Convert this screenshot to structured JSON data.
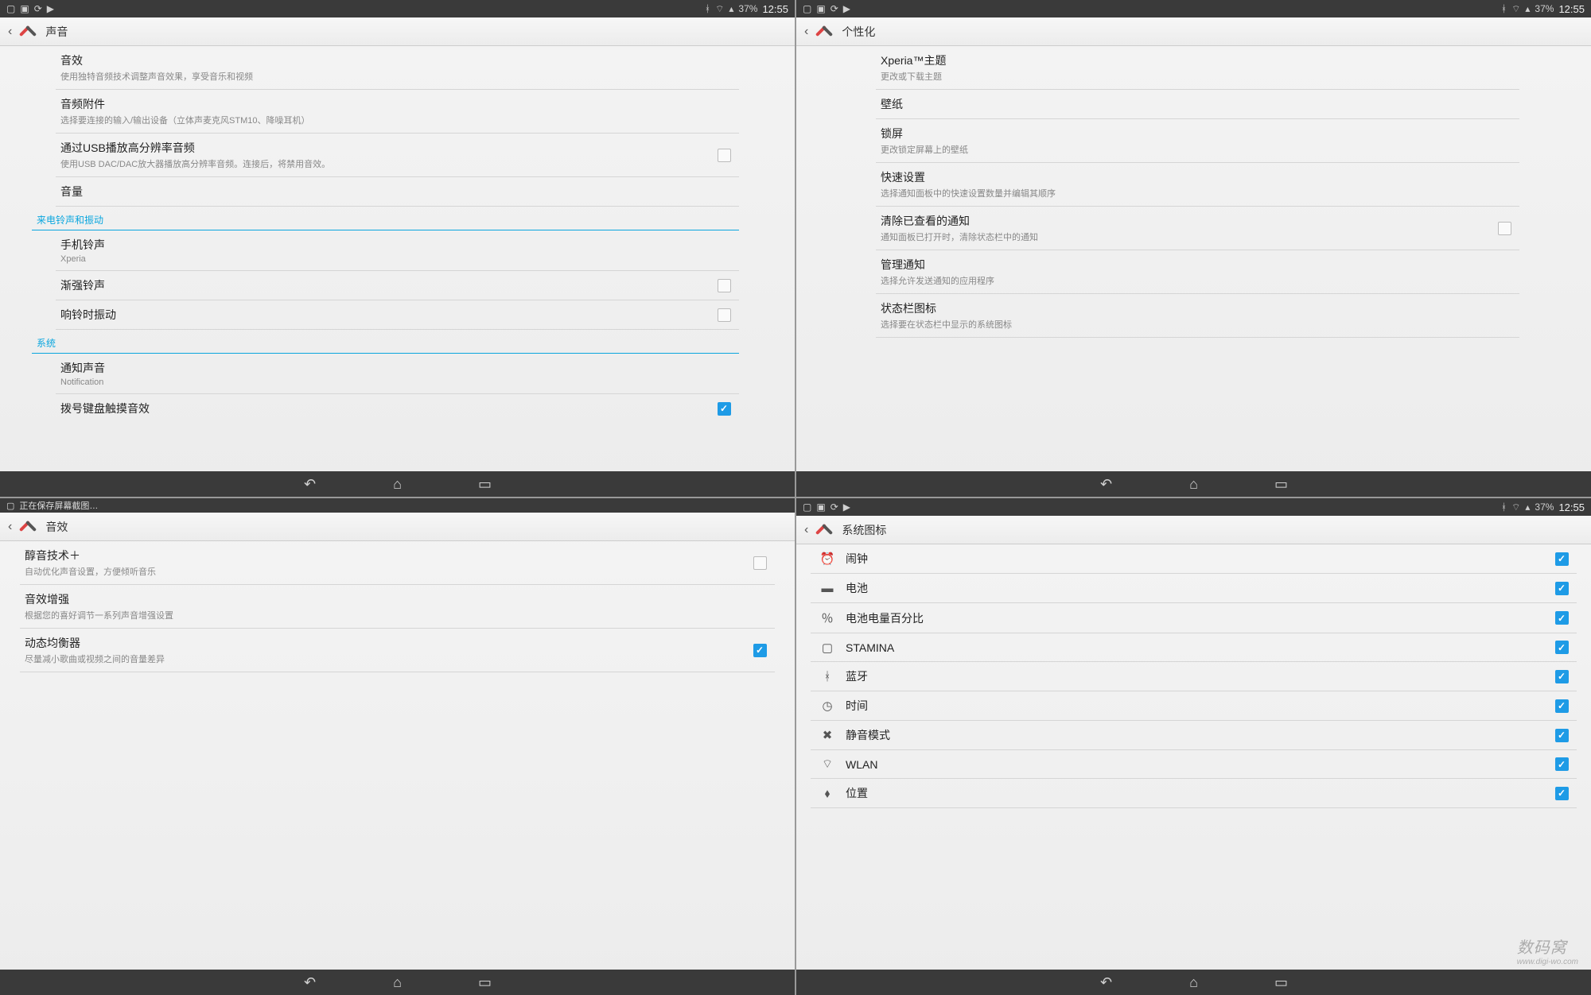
{
  "status": {
    "clock": "12:55",
    "battery": "37%"
  },
  "watermark": {
    "big": "数码窝",
    "small": "www.digi-wo.com"
  },
  "p1": {
    "title": "声音",
    "rows": [
      {
        "k": "sfx",
        "ttl": "音效",
        "sub": "使用独特音频技术调整声音效果，享受音乐和视频"
      },
      {
        "k": "acc",
        "ttl": "音频附件",
        "sub": "选择要连接的输入/输出设备（立体声麦克风STM10、降噪耳机）"
      },
      {
        "k": "usb",
        "ttl": "通过USB播放高分辨率音频",
        "sub": "使用USB DAC/DAC放大器播放高分辨率音频。连接后，将禁用音效。",
        "chk": false
      },
      {
        "k": "vol",
        "ttl": "音量"
      }
    ],
    "cat1": "来电铃声和振动",
    "rows2": [
      {
        "k": "ring",
        "ttl": "手机铃声",
        "sub": "Xperia"
      },
      {
        "k": "asc",
        "ttl": "渐强铃声",
        "chk": false
      },
      {
        "k": "vib",
        "ttl": "响铃时振动",
        "chk": false
      }
    ],
    "cat2": "系统",
    "rows3": [
      {
        "k": "notif",
        "ttl": "通知声音",
        "sub": "Notification"
      },
      {
        "k": "dial",
        "ttl": "拨号键盘触摸音效",
        "chk": true
      }
    ]
  },
  "p2": {
    "title": "个性化",
    "rows": [
      {
        "k": "theme",
        "ttl": "Xperia™主题",
        "sub": "更改或下载主题"
      },
      {
        "k": "wall",
        "ttl": "壁纸"
      },
      {
        "k": "lock",
        "ttl": "锁屏",
        "sub": "更改锁定屏幕上的壁纸"
      },
      {
        "k": "quick",
        "ttl": "快速设置",
        "sub": "选择通知面板中的快速设置数量并编辑其顺序"
      },
      {
        "k": "clear",
        "ttl": "清除已查看的通知",
        "sub": "通知面板已打开时，清除状态栏中的通知",
        "chk": false
      },
      {
        "k": "mng",
        "ttl": "管理通知",
        "sub": "选择允许发送通知的应用程序"
      },
      {
        "k": "icons",
        "ttl": "状态栏图标",
        "sub": "选择要在状态栏中显示的系统图标"
      }
    ]
  },
  "p3": {
    "title": "音效",
    "banner": "正在保存屏幕截图…",
    "rows": [
      {
        "k": "clr",
        "ttl": "醇音技术＋",
        "sub": "自动优化声音设置，方便倾听音乐",
        "chk": false
      },
      {
        "k": "enh",
        "ttl": "音效增强",
        "sub": "根据您的喜好调节一系列声音增强设置"
      },
      {
        "k": "dyn",
        "ttl": "动态均衡器",
        "sub": "尽量减小歌曲或视频之间的音量差异",
        "chk": true
      }
    ]
  },
  "p4": {
    "title": "系统图标",
    "rows": [
      {
        "k": "alarm",
        "ico": "⏰",
        "ttl": "闹钟",
        "chk": true
      },
      {
        "k": "batt",
        "ico": "▬",
        "ttl": "电池",
        "chk": true
      },
      {
        "k": "battpct",
        "ico": "％",
        "ttl": "电池电量百分比",
        "chk": true
      },
      {
        "k": "stam",
        "ico": "▢",
        "ttl": "STAMINA",
        "chk": true
      },
      {
        "k": "bt",
        "ico": "ᚼ",
        "ttl": "蓝牙",
        "chk": true
      },
      {
        "k": "time",
        "ico": "◷",
        "ttl": "时间",
        "chk": true
      },
      {
        "k": "silent",
        "ico": "✖",
        "ttl": "静音模式",
        "chk": true
      },
      {
        "k": "wlan",
        "ico": "⌔",
        "ttl": "WLAN",
        "chk": true
      },
      {
        "k": "loc",
        "ico": "⬧",
        "ttl": "位置",
        "chk": true
      }
    ]
  }
}
